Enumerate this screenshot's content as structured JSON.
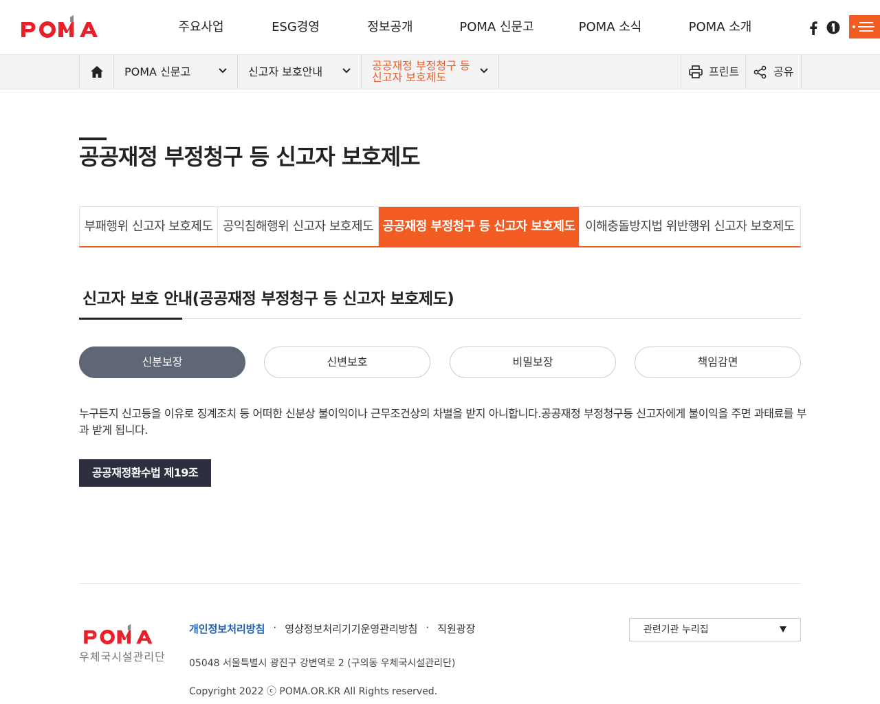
{
  "brand": {
    "logo_text": "POMA",
    "sub_logo": "우체국시설관리단",
    "accent": "#f25b21"
  },
  "gnb": [
    "주요사업",
    "ESG경영",
    "정보공개",
    "POMA 신문고",
    "POMA 소식",
    "POMA 소개"
  ],
  "header_icons": [
    "facebook-icon",
    "blog-icon",
    "menu-icon"
  ],
  "location": {
    "depth1": "POMA 신문고",
    "depth2": "신고자 보호안내",
    "depth3": "공공재정 부정청구 등 신고자 보호제도",
    "print": "프린트",
    "share": "공유"
  },
  "page_title": "공공재정 부정청구 등 신고자 보호제도",
  "tabs": [
    {
      "label": "부패행위 신고자 보호제도",
      "active": false
    },
    {
      "label": "공익침해행위 신고자 보호제도",
      "active": false
    },
    {
      "label": "공공재정 부정청구 등 신고자 보호제도",
      "active": true
    },
    {
      "label": "이해충돌방지법 위반행위 신고자 보호제도",
      "active": false
    }
  ],
  "section_title": "신고자 보호 안내(공공재정 부정청구 등 신고자 보호제도)",
  "pills": [
    {
      "label": "신분보장",
      "active": true
    },
    {
      "label": "신변보호",
      "active": false
    },
    {
      "label": "비밀보장",
      "active": false
    },
    {
      "label": "책임감면",
      "active": false
    }
  ],
  "body_text": "누구든지 신고등을 이유로 징계조치 등 어떠한 신분상 불이익이나 근무조건상의 차별을 받지 아니합니다.공공재정 부정청구등 신고자에게 불이익을 주면 과태료를 부과 받게 됩니다.",
  "law_button": "공공재정환수법 제19조",
  "footer": {
    "links": [
      "개인정보처리방침",
      "영상정보처리기기운영관리방침",
      "직원광장"
    ],
    "address": "05048 서울특별시 광진구 강변역로 2 (구의동 우체국시설관리단)",
    "copyright": "Copyright 2022 ⓒ POMA.OR.KR All Rights reserved.",
    "family_site": "관련기관 누리집"
  }
}
